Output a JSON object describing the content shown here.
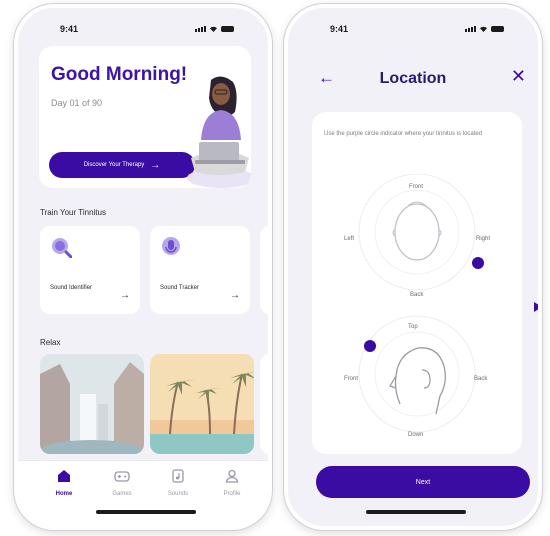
{
  "colors": {
    "accent": "#3a0ca3",
    "title": "#3d14a3",
    "screen_bg": "#f2f1f7"
  },
  "left_screen": {
    "status": {
      "time": "9:41"
    },
    "greeting": {
      "title": "Good Morning!",
      "subtitle": "Day 01 of 90",
      "cta_label": "Discover Your Therapy"
    },
    "train_section": {
      "title": "Train Your Tinnitus"
    },
    "cards": [
      {
        "label": "Sound Identifier",
        "icon": "magnifier-icon"
      },
      {
        "label": "Sound Tracker",
        "icon": "microphone-icon"
      }
    ],
    "relax_section": {
      "title": "Relax"
    },
    "tabs": [
      {
        "label": "Home",
        "icon": "home-icon",
        "active": true
      },
      {
        "label": "Games",
        "icon": "gamepad-icon",
        "active": false
      },
      {
        "label": "Sounds",
        "icon": "music-icon",
        "active": false
      },
      {
        "label": "Profile",
        "icon": "user-icon",
        "active": false
      }
    ]
  },
  "right_screen": {
    "status": {
      "time": "9:41"
    },
    "header": {
      "title": "Location"
    },
    "instructions": "Use the purple circle indicator where your tinnitus is located",
    "top_view": {
      "front": "Front",
      "left": "Left",
      "right": "Right",
      "back": "Back"
    },
    "side_view": {
      "top": "Top",
      "front": "Front",
      "back": "Back",
      "down": "Down"
    },
    "next_label": "Next"
  }
}
